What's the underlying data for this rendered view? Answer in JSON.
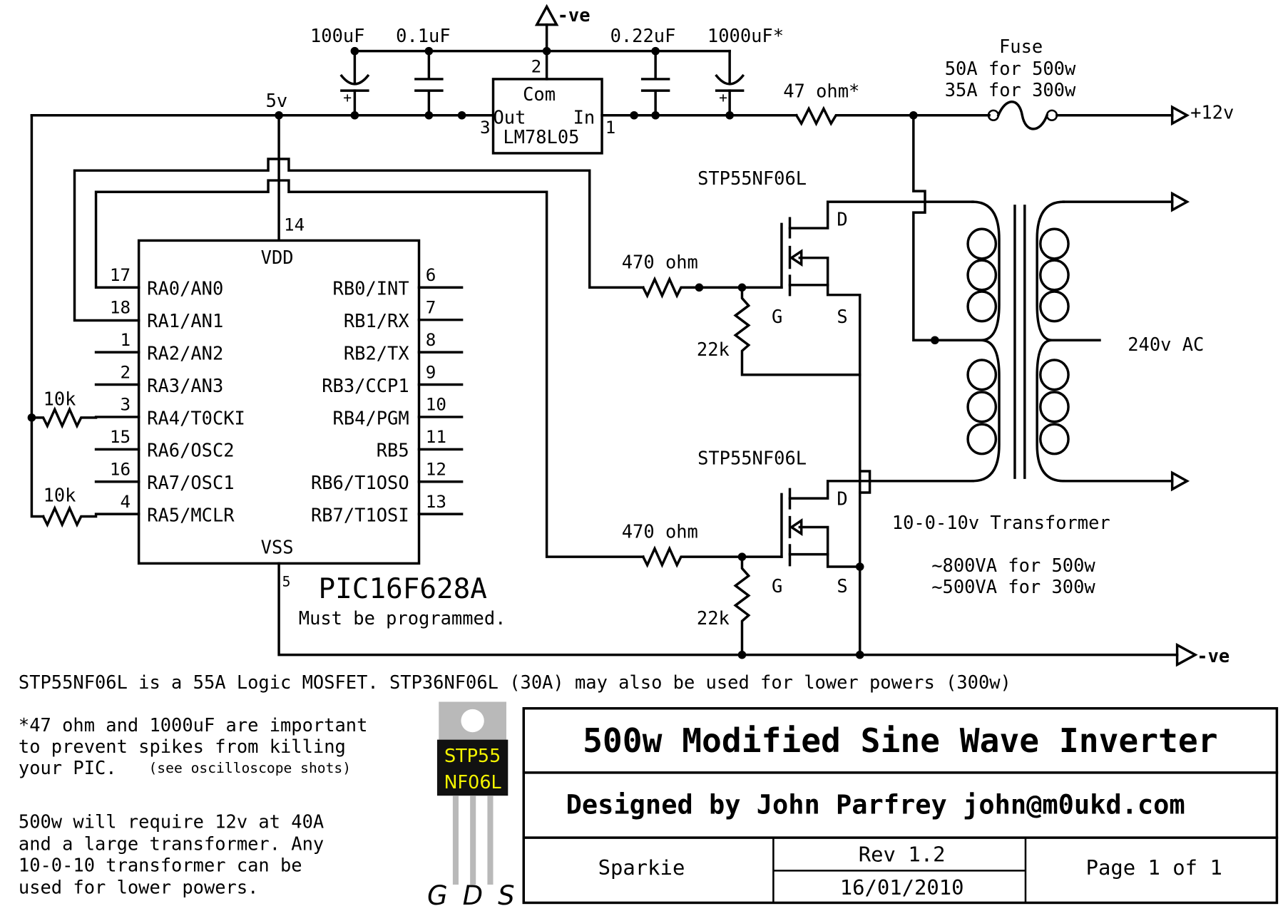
{
  "supply": {
    "regulator": {
      "top_label": "Com",
      "left_pin": "Out",
      "right_pin": "In",
      "part": "LM78L05",
      "pin_out": "3",
      "pin_in": "1",
      "pin_com": "2"
    },
    "caps": [
      "100uF",
      "0.1uF",
      "0.22uF",
      "1000uF*"
    ],
    "rail_5v": "5v",
    "neg_top": "-ve",
    "series_resistor": "47 ohm*",
    "fuse": {
      "title": "Fuse",
      "line1": "50A for 500w",
      "line2": "35A for 300w"
    },
    "pos_in": "+12v"
  },
  "pic": {
    "part": "PIC16F628A",
    "note": "Must be programmed.",
    "vdd": "VDD",
    "vss": "VSS",
    "vdd_pin": "14",
    "vss_pin": "5",
    "left_pins": [
      {
        "num": "17",
        "name": "RA0/AN0"
      },
      {
        "num": "18",
        "name": "RA1/AN1"
      },
      {
        "num": "1",
        "name": "RA2/AN2"
      },
      {
        "num": "2",
        "name": "RA3/AN3"
      },
      {
        "num": "3",
        "name": "RA4/T0CKI"
      },
      {
        "num": "15",
        "name": "RA6/OSC2"
      },
      {
        "num": "16",
        "name": "RA7/OSC1"
      },
      {
        "num": "4",
        "name": "RA5/MCLR"
      }
    ],
    "right_pins": [
      {
        "num": "6",
        "name": "RB0/INT"
      },
      {
        "num": "7",
        "name": "RB1/RX"
      },
      {
        "num": "8",
        "name": "RB2/TX"
      },
      {
        "num": "9",
        "name": "RB3/CCP1"
      },
      {
        "num": "10",
        "name": "RB4/PGM"
      },
      {
        "num": "11",
        "name": "RB5"
      },
      {
        "num": "12",
        "name": "RB6/T1OSO"
      },
      {
        "num": "13",
        "name": "RB7/T1OSI"
      }
    ],
    "pullup_1": "10k",
    "pullup_2": "10k"
  },
  "mosfets": [
    {
      "part": "STP55NF06L",
      "gate_resistor": "470 ohm",
      "pulldown": "22k",
      "g": "G",
      "d": "D",
      "s": "S"
    },
    {
      "part": "STP55NF06L",
      "gate_resistor": "470 ohm",
      "pulldown": "22k",
      "g": "G",
      "d": "D",
      "s": "S"
    }
  ],
  "transformer": {
    "output": "240v AC",
    "label": "10-0-10v Transformer",
    "rating1": "~800VA for 500w",
    "rating2": "~500VA for 300w"
  },
  "neg_bottom": "-ve",
  "notes": {
    "mosfet_note": "STP55NF06L is a 55A Logic MOSFET. STP36NF06L (30A) may also be used for lower powers (300w)",
    "spike_note": [
      "*47 ohm and 1000uF are important",
      "to prevent spikes from killing",
      "your PIC."
    ],
    "spike_note_small": "(see oscilloscope shots)",
    "power_note": [
      "500w will require 12v at 40A",
      "and a large transformer. Any",
      "10-0-10 transformer can be",
      "used for lower powers."
    ]
  },
  "package": {
    "line1": "STP55",
    "line2": "NF06L",
    "pins": "G D S",
    "text_color": "#f5f500",
    "body_color": "#111111",
    "tab_color": "#b9b9b9"
  },
  "title_block": {
    "title": "500w Modified Sine Wave Inverter",
    "designer": "Designed by John Parfrey john@m0ukd.com",
    "name": "Sparkie",
    "rev": "Rev 1.2",
    "date": "16/01/2010",
    "page": "Page 1 of 1"
  }
}
